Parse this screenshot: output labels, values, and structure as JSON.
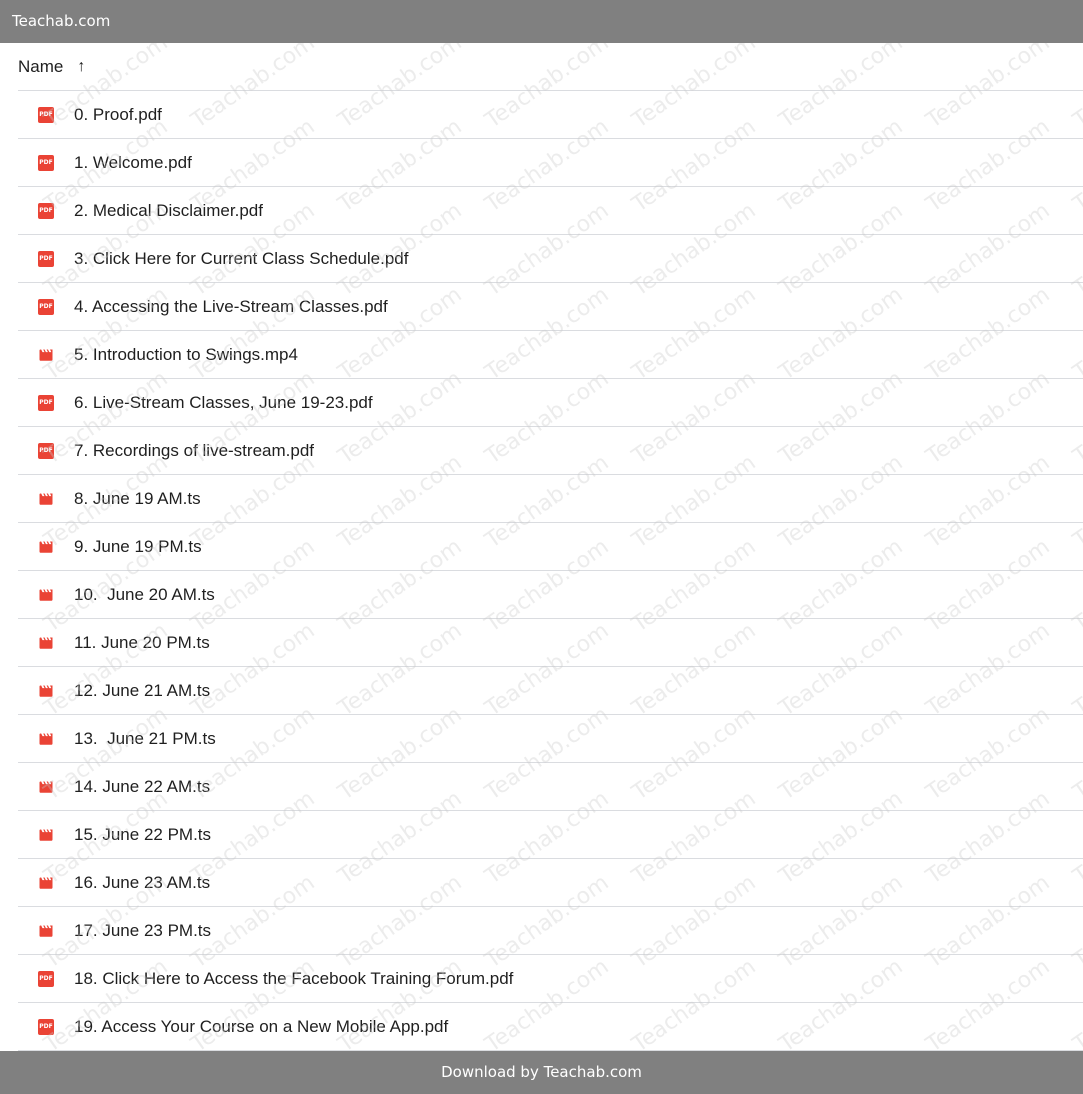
{
  "top_bar": {
    "title": "Teachab.com"
  },
  "header": {
    "name_label": "Name",
    "sort_arrow": "↑"
  },
  "files": [
    {
      "name": "0. Proof.pdf",
      "type": "pdf"
    },
    {
      "name": "1. Welcome.pdf",
      "type": "pdf"
    },
    {
      "name": "2. Medical Disclaimer.pdf",
      "type": "pdf"
    },
    {
      "name": "3. Click Here for Current Class Schedule.pdf",
      "type": "pdf"
    },
    {
      "name": "4. Accessing the Live-Stream Classes.pdf",
      "type": "pdf"
    },
    {
      "name": "5. Introduction to Swings.mp4",
      "type": "video"
    },
    {
      "name": "6. Live-Stream Classes, June 19-23.pdf",
      "type": "pdf"
    },
    {
      "name": "7. Recordings of live-stream.pdf",
      "type": "pdf"
    },
    {
      "name": "8. June 19 AM.ts",
      "type": "video"
    },
    {
      "name": "9. June 19 PM.ts",
      "type": "video"
    },
    {
      "name": "10.  June 20 AM.ts",
      "type": "video"
    },
    {
      "name": "11. June 20 PM.ts",
      "type": "video"
    },
    {
      "name": "12. June 21 AM.ts",
      "type": "video"
    },
    {
      "name": "13.  June 21 PM.ts",
      "type": "video"
    },
    {
      "name": "14. June 22 AM.ts",
      "type": "video"
    },
    {
      "name": "15. June 22 PM.ts",
      "type": "video"
    },
    {
      "name": "16. June 23 AM.ts",
      "type": "video"
    },
    {
      "name": "17. June 23 PM.ts",
      "type": "video"
    },
    {
      "name": "18. Click Here to Access the Facebook Training Forum.pdf",
      "type": "pdf"
    },
    {
      "name": "19. Access Your Course on a New Mobile App.pdf",
      "type": "pdf"
    }
  ],
  "icons": {
    "pdf": "pdf-file-icon",
    "video": "video-file-icon",
    "pdf_icon_text": "PDF"
  },
  "watermark": {
    "text": "Teachab.com"
  },
  "bottom_bar": {
    "text": "Download by Teachab.com"
  },
  "colors": {
    "bar": "#808080",
    "icon_red": "#ea4335",
    "divider": "#dadce0"
  }
}
